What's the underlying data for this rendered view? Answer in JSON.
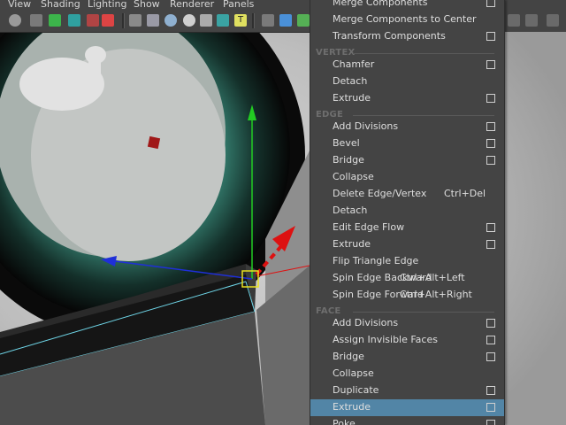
{
  "menubar": {
    "items": [
      "View",
      "Shading",
      "Lighting",
      "Show",
      "Renderer",
      "Panels"
    ]
  },
  "toolbar": {
    "icons": [
      "camera-icon",
      "film-icon",
      "bookmark-icon",
      "image-plane-icon",
      "grid-icon",
      "paint-icon",
      "wireframe-icon",
      "smooth-shade-icon",
      "bounding-box-icon",
      "lights-icon",
      "texture-icon",
      "xray-icon",
      "isolate-icon",
      "cube-icon"
    ]
  },
  "menu": {
    "top_items": [
      {
        "label": "Merge Components",
        "option_box": true
      },
      {
        "label": "Merge Components to Center",
        "option_box": false
      },
      {
        "label": "Transform Components",
        "option_box": true
      }
    ],
    "sections": [
      {
        "header": "VERTEX",
        "items": [
          {
            "label": "Chamfer",
            "option_box": true
          },
          {
            "label": "Detach",
            "option_box": false
          },
          {
            "label": "Extrude",
            "option_box": true
          }
        ]
      },
      {
        "header": "EDGE",
        "items": [
          {
            "label": "Add Divisions",
            "option_box": true
          },
          {
            "label": "Bevel",
            "option_box": true
          },
          {
            "label": "Bridge",
            "option_box": true
          },
          {
            "label": "Collapse",
            "option_box": false
          },
          {
            "label": "Delete Edge/Vertex",
            "shortcut": "Ctrl+Del",
            "option_box": false
          },
          {
            "label": "Detach",
            "option_box": false
          },
          {
            "label": "Edit Edge Flow",
            "option_box": true
          },
          {
            "label": "Extrude",
            "option_box": true
          },
          {
            "label": "Flip Triangle Edge",
            "option_box": false
          },
          {
            "label": "Spin Edge Backward",
            "shortcut": "Ctrl+Alt+Left",
            "option_box": false
          },
          {
            "label": "Spin Edge Forward",
            "shortcut": "Ctrl+Alt+Right",
            "option_box": false
          }
        ]
      },
      {
        "header": "FACE",
        "items": [
          {
            "label": "Add Divisions",
            "option_box": true
          },
          {
            "label": "Assign Invisible Faces",
            "option_box": true
          },
          {
            "label": "Bridge",
            "option_box": true
          },
          {
            "label": "Collapse",
            "option_box": false
          },
          {
            "label": "Duplicate",
            "option_box": true
          },
          {
            "label": "Extrude",
            "option_box": true,
            "highlighted": true
          },
          {
            "label": "Poke",
            "option_box": true
          }
        ]
      }
    ]
  },
  "colors": {
    "menu_bg": "#444444",
    "highlight": "#5285a6",
    "axis_y": "#22cc22",
    "axis_x": "#1f2fd8",
    "axis_z": "#dd1111"
  }
}
